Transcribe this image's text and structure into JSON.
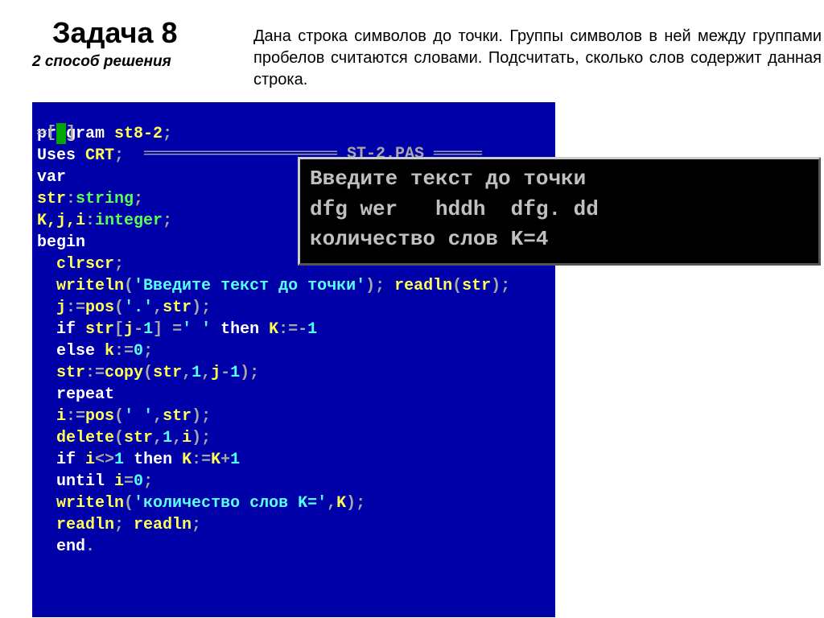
{
  "header": {
    "title": "Задача 8",
    "subtitle": "2 способ решения",
    "description": "Дана строка символов до точки. Группы символов в ней между группами пробелов считаются словами. Подсчитать, сколько слов содержит данная строка."
  },
  "editor": {
    "filename": "ST-2.PAS",
    "code": {
      "l1_kw": "program ",
      "l1_id": "st8-2",
      "l1_sc": ";",
      "l2_kw": "Uses ",
      "l2_id": "CRT",
      "l2_sc": ";",
      "l3_kw": "var",
      "l4_id": "str",
      "l4_colon": ":",
      "l4_type": "string",
      "l4_sc": ";",
      "l5_ids": "K,j,i",
      "l5_colon": ":",
      "l5_type": "integer",
      "l5_sc": ";",
      "l6_kw": "begin",
      "l7_id": "  clrscr",
      "l7_sc": ";",
      "l8_id1": "  writeln",
      "l8_p1": "(",
      "l8_str": "'Введите текст до точки'",
      "l8_p2": "); ",
      "l8_id2": "readln",
      "l8_p3": "(",
      "l8_id3": "str",
      "l8_p4": ");",
      "l9_id1": "  j",
      "l9_op1": ":=",
      "l9_id2": "pos",
      "l9_p1": "(",
      "l9_str": "'.'",
      "l9_c": ",",
      "l9_id3": "str",
      "l9_p2": ");",
      "l10_kw1": "  if ",
      "l10_id1": "str",
      "l10_b1": "[",
      "l10_id2": "j",
      "l10_m": "-",
      "l10_n1": "1",
      "l10_b2": "] =",
      "l10_str": "' '",
      "l10_kw2": " then ",
      "l10_id3": "K",
      "l10_op": ":=-",
      "l10_n2": "1",
      "l11_kw": "  else ",
      "l11_id": "k",
      "l11_op": ":=",
      "l11_n": "0",
      "l11_sc": ";",
      "l12_id1": "  str",
      "l12_op": ":=",
      "l12_id2": "copy",
      "l12_p1": "(",
      "l12_id3": "str",
      "l12_c1": ",",
      "l12_n1": "1",
      "l12_c2": ",",
      "l12_id4": "j",
      "l12_m": "-",
      "l12_n2": "1",
      "l12_p2": ");",
      "l13_kw": "  repeat",
      "l14_id1": "  i",
      "l14_op": ":=",
      "l14_id2": "pos",
      "l14_p1": "(",
      "l14_str": "' '",
      "l14_c": ",",
      "l14_id3": "str",
      "l14_p2": ");",
      "l15_id1": "  delete",
      "l15_p1": "(",
      "l15_id2": "str",
      "l15_c1": ",",
      "l15_n1": "1",
      "l15_c2": ",",
      "l15_id3": "i",
      "l15_p2": ");",
      "l16_kw1": "  if ",
      "l16_id1": "i",
      "l16_op1": "<>",
      "l16_n1": "1",
      "l16_kw2": " then ",
      "l16_id2": "K",
      "l16_op2": ":=",
      "l16_id3": "K",
      "l16_plus": "+",
      "l16_n2": "1",
      "l17_kw": "  until ",
      "l17_id": "i",
      "l17_eq": "=",
      "l17_n": "0",
      "l17_sc": ";",
      "l18_id1": "  writeln",
      "l18_p1": "(",
      "l18_str": "'количество слов K='",
      "l18_c": ",",
      "l18_id2": "K",
      "l18_p2": ");",
      "l19_id1": "  readln",
      "l19_sc1": "; ",
      "l19_id2": "readln",
      "l19_sc2": ";",
      "l20_kw": "  end",
      "l20_dot": "."
    }
  },
  "output": {
    "line1": "Введите текст до точки",
    "line2": "dfg wer   hddh  dfg. dd",
    "line3": "количество слов K=4"
  }
}
